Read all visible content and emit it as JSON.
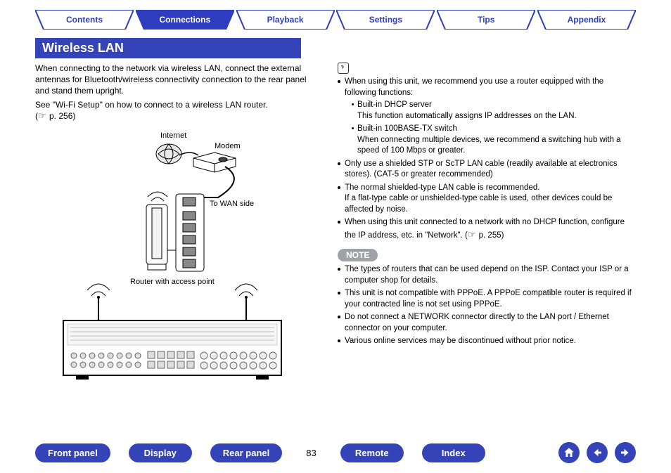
{
  "tabs": {
    "contents": "Contents",
    "connections": "Connections",
    "playback": "Playback",
    "settings": "Settings",
    "tips": "Tips",
    "appendix": "Appendix"
  },
  "heading": "Wireless LAN",
  "intro": "When connecting to the network via wireless LAN, connect the external antennas for Bluetooth/wireless connectivity connection to the rear panel and stand them upright.",
  "wifi_line": "See \"Wi-Fi Setup\" on how to connect to a wireless LAN router.",
  "pageref_prefix": " (",
  "pageref_text": "p. 256)",
  "diagram": {
    "internet": "Internet",
    "modem": "Modem",
    "to_wan": "To WAN side",
    "router_label": "Router with access point"
  },
  "right": {
    "b1": "When using this unit, we recommend you use a router equipped with the following functions:",
    "b1a_head": "Built-in DHCP server",
    "b1a_body": "This function automatically assigns IP addresses on the LAN.",
    "b1b_head": "Built-in 100BASE-TX switch",
    "b1b_body": "When connecting multiple devices, we recommend a switching hub with a speed of 100 Mbps or greater.",
    "b2": "Only use a shielded STP or ScTP LAN cable (readily available at electronics stores). (CAT-5 or greater recommended)",
    "b3a": "The normal shielded-type LAN cable is recommended.",
    "b3b": "If a flat-type cable or unshielded-type cable is used, other devices could be affected by noise.",
    "b4_a": "When using this unit connected to a network with no DHCP function, configure the IP address, etc. in \"Network\".  (",
    "b4_pageref": "p. 255)",
    "note_label": "NOTE",
    "n1": "The types of routers that can be used depend on the ISP. Contact your ISP or a computer shop for details.",
    "n2": "This unit is not compatible with PPPoE. A PPPoE compatible router is required if your contracted line is not set using PPPoE.",
    "n3": "Do not connect a NETWORK connector directly to the LAN port / Ethernet connector on your computer.",
    "n4": "Various online services may be discontinued without prior notice."
  },
  "bottom": {
    "front_panel": "Front panel",
    "display": "Display",
    "rear_panel": "Rear panel",
    "page": "83",
    "remote": "Remote",
    "index": "Index"
  }
}
